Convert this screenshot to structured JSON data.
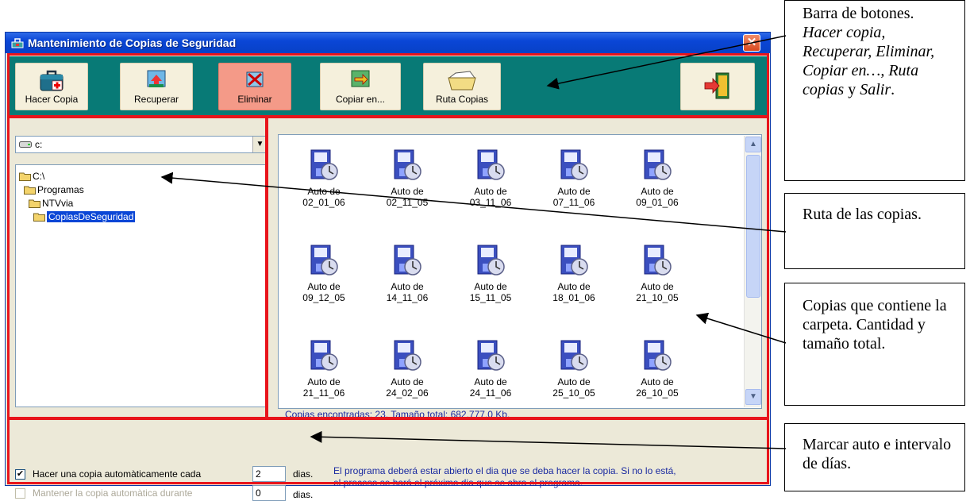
{
  "window": {
    "title": "Mantenimiento de Copias de Seguridad",
    "close_label": "✕"
  },
  "toolbar": {
    "buttons": [
      {
        "label": "Hacer Copia",
        "icon": "first-aid-kit-icon"
      },
      {
        "label": "Recuperar",
        "icon": "restore-icon"
      },
      {
        "label": "Eliminar",
        "icon": "delete-icon"
      },
      {
        "label": "Copiar en...",
        "icon": "copy-to-icon"
      },
      {
        "label": "Ruta Copias",
        "icon": "folder-path-icon"
      },
      {
        "label": "",
        "icon": "exit-door-icon"
      }
    ]
  },
  "drive": {
    "value": "c:"
  },
  "tree": {
    "items": [
      {
        "label": "C:\\"
      },
      {
        "label": "Programas"
      },
      {
        "label": "NTVvia"
      },
      {
        "label": "CopiasDeSeguridad"
      }
    ]
  },
  "files": [
    {
      "line1": "Auto de",
      "line2": "02_01_06"
    },
    {
      "line1": "Auto de",
      "line2": "02_11_05"
    },
    {
      "line1": "Auto de",
      "line2": "03_11_06"
    },
    {
      "line1": "Auto de",
      "line2": "07_11_06"
    },
    {
      "line1": "Auto de",
      "line2": "09_01_06"
    },
    {
      "line1": "Auto de",
      "line2": "09_12_05"
    },
    {
      "line1": "Auto de",
      "line2": "14_11_06"
    },
    {
      "line1": "Auto de",
      "line2": "15_11_05"
    },
    {
      "line1": "Auto de",
      "line2": "18_01_06"
    },
    {
      "line1": "Auto de",
      "line2": "21_10_05"
    },
    {
      "line1": "Auto de",
      "line2": "21_11_06"
    },
    {
      "line1": "Auto de",
      "line2": "24_02_06"
    },
    {
      "line1": "Auto de",
      "line2": "24_11_06"
    },
    {
      "line1": "Auto de",
      "line2": "25_10_05"
    },
    {
      "line1": "Auto de",
      "line2": "26_10_05"
    }
  ],
  "status": {
    "text": "Copias encontradas: 23. Tamaño total: 682.777,0 Kb."
  },
  "options": {
    "auto_label": "Hacer una copia automàticamente cada",
    "auto_checked": "✔",
    "auto_days": "2",
    "days_label_1": "dias.",
    "keep_label": "Mantener la copia automàtica durante",
    "keep_days": "0",
    "days_label_2": "dias.",
    "info_line1": "El programa deberá estar abierto el dia que se deba hacer la copia. Si no lo está,",
    "info_line2": "el proceso se hará el próximo dia que se abra el programa."
  },
  "notes": {
    "toolbar_title": "Barra de botones.",
    "toolbar_italic": "Hacer copia, Recuperar, Eliminar, Copiar en…, Ruta copias",
    "toolbar_and": "y",
    "toolbar_exit": "Salir",
    "toolbar_end": ".",
    "path": "Ruta de las copias.",
    "files": "Copias que contiene la carpeta. Cantidad y tamaño total.",
    "auto": "Marcar auto e intervalo de días."
  },
  "colors": {
    "toolbar_bg": "#087a76",
    "annotation_red": "#e8141b",
    "selection": "#0a46d6"
  }
}
